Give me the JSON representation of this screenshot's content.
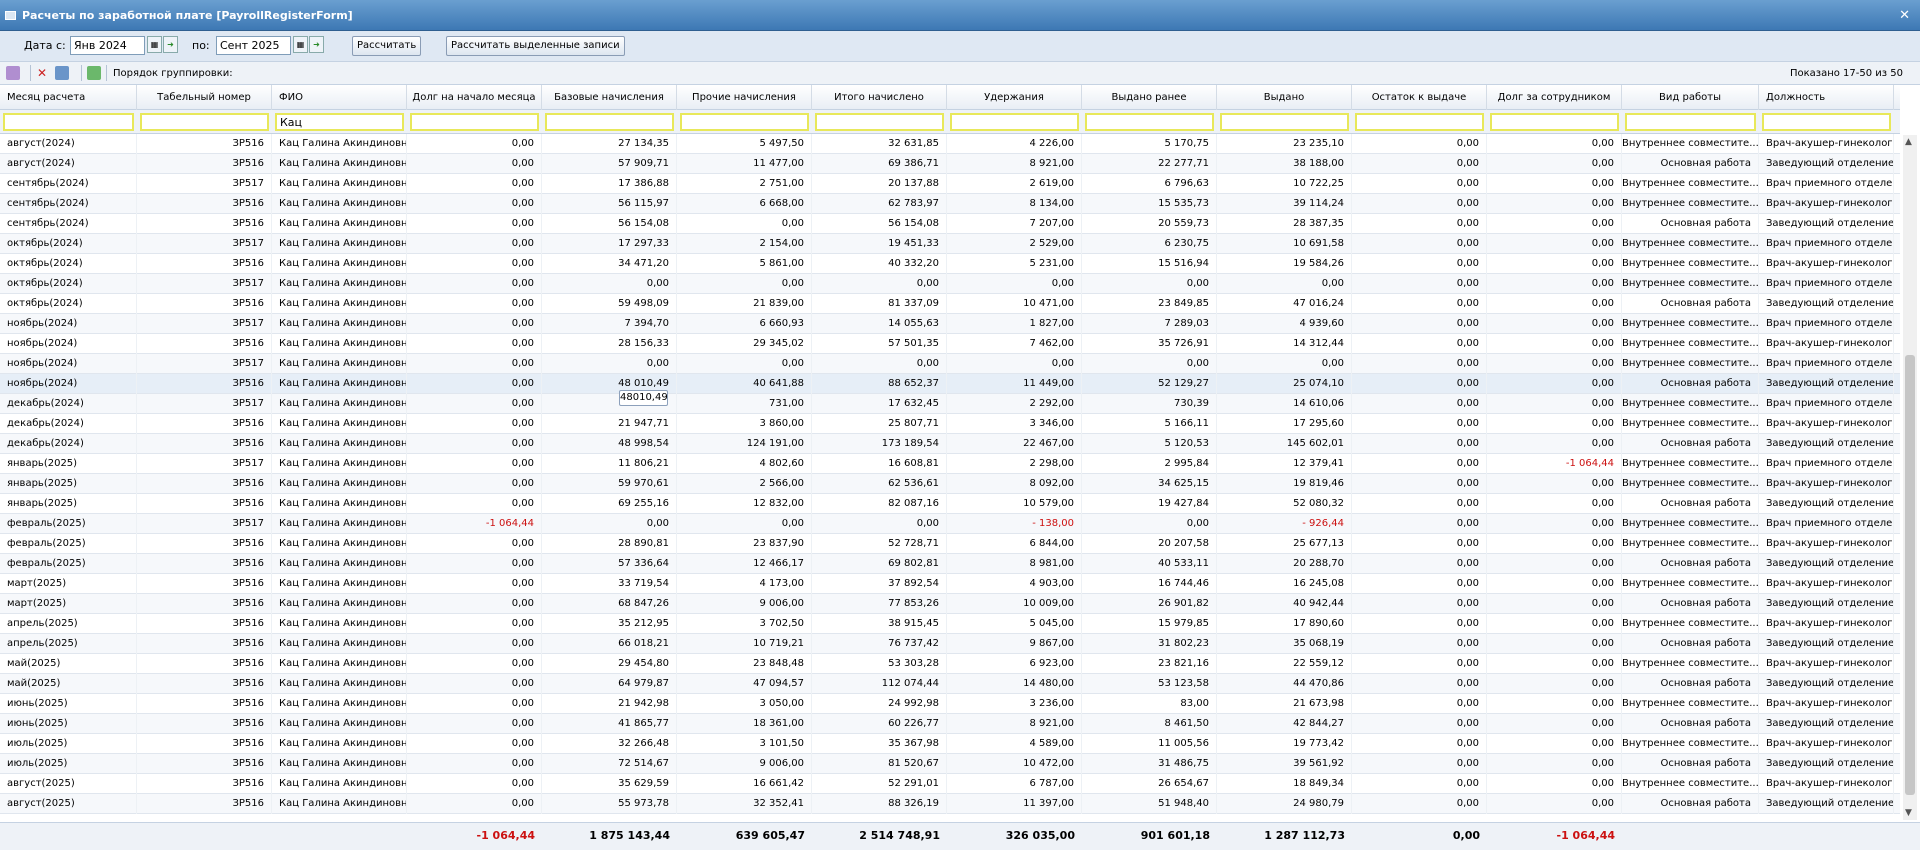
{
  "window": {
    "title": "Расчеты по заработной плате [PayrollRegisterForm]"
  },
  "filters": {
    "date_from_label": "Дата с:",
    "date_from": "Янв 2024",
    "date_to_label": "по:",
    "date_to": "Сент 2025",
    "calc_button": "Рассчитать",
    "calc_selected_button": "Рассчитать выделенные записи"
  },
  "toolbar": {
    "grouping_label": "Порядок группировки:",
    "shown_count": "Показано 17-50 из 50"
  },
  "columns": [
    "Месяц расчета",
    "Табельный номер",
    "ФИО",
    "Долг на начало месяца",
    "Базовые начисления",
    "Прочие начисления",
    "Итого начислено",
    "Удержания",
    "Выдано ранее",
    "Выдано",
    "Остаток к выдаче",
    "Долг за сотрудником",
    "Вид работы",
    "Должность"
  ],
  "filter_values": {
    "fio": "Кац"
  },
  "rows": [
    [
      "август(2024)",
      "ЗР516",
      "Кац Галина Акиндиновна",
      "0,00",
      "27 134,35",
      "5 497,50",
      "32 631,85",
      "4 226,00",
      "5 170,75",
      "23 235,10",
      "0,00",
      "0,00",
      "Внутреннее совместите...",
      "Врач-акушер-гинеколог"
    ],
    [
      "август(2024)",
      "ЗР516",
      "Кац Галина Акиндиновна",
      "0,00",
      "57 909,71",
      "11 477,00",
      "69 386,71",
      "8 921,00",
      "22 277,71",
      "38 188,00",
      "0,00",
      "0,00",
      "Основная работа",
      "Заведующий отделение..."
    ],
    [
      "сентябрь(2024)",
      "ЗР517",
      "Кац Галина Акиндиновна",
      "0,00",
      "17 386,88",
      "2 751,00",
      "20 137,88",
      "2 619,00",
      "6 796,63",
      "10 722,25",
      "0,00",
      "0,00",
      "Внутреннее совместите...",
      "Врач приемного отделе..."
    ],
    [
      "сентябрь(2024)",
      "ЗР516",
      "Кац Галина Акиндиновна",
      "0,00",
      "56 115,97",
      "6 668,00",
      "62 783,97",
      "8 134,00",
      "15 535,73",
      "39 114,24",
      "0,00",
      "0,00",
      "Внутреннее совместите...",
      "Врач-акушер-гинеколог"
    ],
    [
      "сентябрь(2024)",
      "ЗР516",
      "Кац Галина Акиндиновна",
      "0,00",
      "56 154,08",
      "0,00",
      "56 154,08",
      "7 207,00",
      "20 559,73",
      "28 387,35",
      "0,00",
      "0,00",
      "Основная работа",
      "Заведующий отделение..."
    ],
    [
      "октябрь(2024)",
      "ЗР517",
      "Кац Галина Акиндиновна",
      "0,00",
      "17 297,33",
      "2 154,00",
      "19 451,33",
      "2 529,00",
      "6 230,75",
      "10 691,58",
      "0,00",
      "0,00",
      "Внутреннее совместите...",
      "Врач приемного отделе..."
    ],
    [
      "октябрь(2024)",
      "ЗР516",
      "Кац Галина Акиндиновна",
      "0,00",
      "34 471,20",
      "5 861,00",
      "40 332,20",
      "5 231,00",
      "15 516,94",
      "19 584,26",
      "0,00",
      "0,00",
      "Внутреннее совместите...",
      "Врач-акушер-гинеколог"
    ],
    [
      "октябрь(2024)",
      "ЗР517",
      "Кац Галина Акиндиновна",
      "0,00",
      "0,00",
      "0,00",
      "0,00",
      "0,00",
      "0,00",
      "0,00",
      "0,00",
      "0,00",
      "Внутреннее совместите...",
      "Врач приемного отделе..."
    ],
    [
      "октябрь(2024)",
      "ЗР516",
      "Кац Галина Акиндиновна",
      "0,00",
      "59 498,09",
      "21 839,00",
      "81 337,09",
      "10 471,00",
      "23 849,85",
      "47 016,24",
      "0,00",
      "0,00",
      "Основная работа",
      "Заведующий отделение..."
    ],
    [
      "ноябрь(2024)",
      "ЗР517",
      "Кац Галина Акиндиновна",
      "0,00",
      "7 394,70",
      "6 660,93",
      "14 055,63",
      "1 827,00",
      "7 289,03",
      "4 939,60",
      "0,00",
      "0,00",
      "Внутреннее совместите...",
      "Врач приемного отделе..."
    ],
    [
      "ноябрь(2024)",
      "ЗР516",
      "Кац Галина Акиндиновна",
      "0,00",
      "28 156,33",
      "29 345,02",
      "57 501,35",
      "7 462,00",
      "35 726,91",
      "14 312,44",
      "0,00",
      "0,00",
      "Внутреннее совместите...",
      "Врач-акушер-гинеколог"
    ],
    [
      "ноябрь(2024)",
      "ЗР517",
      "Кац Галина Акиндиновна",
      "0,00",
      "0,00",
      "0,00",
      "0,00",
      "0,00",
      "0,00",
      "0,00",
      "0,00",
      "0,00",
      "Внутреннее совместите...",
      "Врач приемного отделе..."
    ],
    [
      "ноябрь(2024)",
      "ЗР516",
      "Кац Галина Акиндиновна",
      "0,00",
      "48 010,49",
      "40 641,88",
      "88 652,37",
      "11 449,00",
      "52 129,27",
      "25 074,10",
      "0,00",
      "0,00",
      "Основная работа",
      "Заведующий отделение..."
    ],
    [
      "декабрь(2024)",
      "ЗР517",
      "Кац Галина Акиндиновна",
      "0,00",
      "",
      "731,00",
      "17 632,45",
      "2 292,00",
      "730,39",
      "14 610,06",
      "0,00",
      "0,00",
      "Внутреннее совместите...",
      "Врач приемного отделе..."
    ],
    [
      "декабрь(2024)",
      "ЗР516",
      "Кац Галина Акиндиновна",
      "0,00",
      "21 947,71",
      "3 860,00",
      "25 807,71",
      "3 346,00",
      "5 166,11",
      "17 295,60",
      "0,00",
      "0,00",
      "Внутреннее совместите...",
      "Врач-акушер-гинеколог"
    ],
    [
      "декабрь(2024)",
      "ЗР516",
      "Кац Галина Акиндиновна",
      "0,00",
      "48 998,54",
      "124 191,00",
      "173 189,54",
      "22 467,00",
      "5 120,53",
      "145 602,01",
      "0,00",
      "0,00",
      "Основная работа",
      "Заведующий отделение..."
    ],
    [
      "январь(2025)",
      "ЗР517",
      "Кац Галина Акиндиновна",
      "0,00",
      "11 806,21",
      "4 802,60",
      "16 608,81",
      "2 298,00",
      "2 995,84",
      "12 379,41",
      "0,00",
      "-1 064,44",
      "Внутреннее совместите...",
      "Врач приемного отделе..."
    ],
    [
      "январь(2025)",
      "ЗР516",
      "Кац Галина Акиндиновна",
      "0,00",
      "59 970,61",
      "2 566,00",
      "62 536,61",
      "8 092,00",
      "34 625,15",
      "19 819,46",
      "0,00",
      "0,00",
      "Внутреннее совместите...",
      "Врач-акушер-гинеколог"
    ],
    [
      "январь(2025)",
      "ЗР516",
      "Кац Галина Акиндиновна",
      "0,00",
      "69 255,16",
      "12 832,00",
      "82 087,16",
      "10 579,00",
      "19 427,84",
      "52 080,32",
      "0,00",
      "0,00",
      "Основная работа",
      "Заведующий отделение..."
    ],
    [
      "февраль(2025)",
      "ЗР517",
      "Кац Галина Акиндиновна",
      "-1 064,44",
      "0,00",
      "0,00",
      "0,00",
      "- 138,00",
      "0,00",
      "- 926,44",
      "0,00",
      "0,00",
      "Внутреннее совместите...",
      "Врач приемного отделе..."
    ],
    [
      "февраль(2025)",
      "ЗР516",
      "Кац Галина Акиндиновна",
      "0,00",
      "28 890,81",
      "23 837,90",
      "52 728,71",
      "6 844,00",
      "20 207,58",
      "25 677,13",
      "0,00",
      "0,00",
      "Внутреннее совместите...",
      "Врач-акушер-гинеколог"
    ],
    [
      "февраль(2025)",
      "ЗР516",
      "Кац Галина Акиндиновна",
      "0,00",
      "57 336,64",
      "12 466,17",
      "69 802,81",
      "8 981,00",
      "40 533,11",
      "20 288,70",
      "0,00",
      "0,00",
      "Основная работа",
      "Заведующий отделение..."
    ],
    [
      "март(2025)",
      "ЗР516",
      "Кац Галина Акиндиновна",
      "0,00",
      "33 719,54",
      "4 173,00",
      "37 892,54",
      "4 903,00",
      "16 744,46",
      "16 245,08",
      "0,00",
      "0,00",
      "Внутреннее совместите...",
      "Врач-акушер-гинеколог"
    ],
    [
      "март(2025)",
      "ЗР516",
      "Кац Галина Акиндиновна",
      "0,00",
      "68 847,26",
      "9 006,00",
      "77 853,26",
      "10 009,00",
      "26 901,82",
      "40 942,44",
      "0,00",
      "0,00",
      "Основная работа",
      "Заведующий отделение..."
    ],
    [
      "апрель(2025)",
      "ЗР516",
      "Кац Галина Акиндиновна",
      "0,00",
      "35 212,95",
      "3 702,50",
      "38 915,45",
      "5 045,00",
      "15 979,85",
      "17 890,60",
      "0,00",
      "0,00",
      "Внутреннее совместите...",
      "Врач-акушер-гинеколог"
    ],
    [
      "апрель(2025)",
      "ЗР516",
      "Кац Галина Акиндиновна",
      "0,00",
      "66 018,21",
      "10 719,21",
      "76 737,42",
      "9 867,00",
      "31 802,23",
      "35 068,19",
      "0,00",
      "0,00",
      "Основная работа",
      "Заведующий отделение..."
    ],
    [
      "май(2025)",
      "ЗР516",
      "Кац Галина Акиндиновна",
      "0,00",
      "29 454,80",
      "23 848,48",
      "53 303,28",
      "6 923,00",
      "23 821,16",
      "22 559,12",
      "0,00",
      "0,00",
      "Внутреннее совместите...",
      "Врач-акушер-гинеколог"
    ],
    [
      "май(2025)",
      "ЗР516",
      "Кац Галина Акиндиновна",
      "0,00",
      "64 979,87",
      "47 094,57",
      "112 074,44",
      "14 480,00",
      "53 123,58",
      "44 470,86",
      "0,00",
      "0,00",
      "Основная работа",
      "Заведующий отделение..."
    ],
    [
      "июнь(2025)",
      "ЗР516",
      "Кац Галина Акиндиновна",
      "0,00",
      "21 942,98",
      "3 050,00",
      "24 992,98",
      "3 236,00",
      "83,00",
      "21 673,98",
      "0,00",
      "0,00",
      "Внутреннее совместите...",
      "Врач-акушер-гинеколог"
    ],
    [
      "июнь(2025)",
      "ЗР516",
      "Кац Галина Акиндиновна",
      "0,00",
      "41 865,77",
      "18 361,00",
      "60 226,77",
      "8 921,00",
      "8 461,50",
      "42 844,27",
      "0,00",
      "0,00",
      "Основная работа",
      "Заведующий отделение..."
    ],
    [
      "июль(2025)",
      "ЗР516",
      "Кац Галина Акиндиновна",
      "0,00",
      "32 266,48",
      "3 101,50",
      "35 367,98",
      "4 589,00",
      "11 005,56",
      "19 773,42",
      "0,00",
      "0,00",
      "Внутреннее совместите...",
      "Врач-акушер-гинеколог"
    ],
    [
      "июль(2025)",
      "ЗР516",
      "Кац Галина Акиндиновна",
      "0,00",
      "72 514,67",
      "9 006,00",
      "81 520,67",
      "10 472,00",
      "31 486,75",
      "39 561,92",
      "0,00",
      "0,00",
      "Основная работа",
      "Заведующий отделение..."
    ],
    [
      "август(2025)",
      "ЗР516",
      "Кац Галина Акиндиновна",
      "0,00",
      "35 629,59",
      "16 661,42",
      "52 291,01",
      "6 787,00",
      "26 654,67",
      "18 849,34",
      "0,00",
      "0,00",
      "Внутреннее совместите...",
      "Врач-акушер-гинеколог"
    ],
    [
      "август(2025)",
      "ЗР516",
      "Кац Галина Акиндиновна",
      "0,00",
      "55 973,78",
      "32 352,41",
      "88 326,19",
      "11 397,00",
      "51 948,40",
      "24 980,79",
      "0,00",
      "0,00",
      "Основная работа",
      "Заведующий отделение..."
    ]
  ],
  "totals": [
    "-1 064,44",
    "1 875 143,44",
    "639 605,47",
    "2 514 748,91",
    "326 035,00",
    "901 601,18",
    "1 287 112,73",
    "0,00",
    "-1 064,44"
  ],
  "tooltip": "48010,49",
  "colors": {
    "titlebar": "#3d78b4",
    "negative": "#cc1111",
    "filter_border": "#e8e85a"
  }
}
